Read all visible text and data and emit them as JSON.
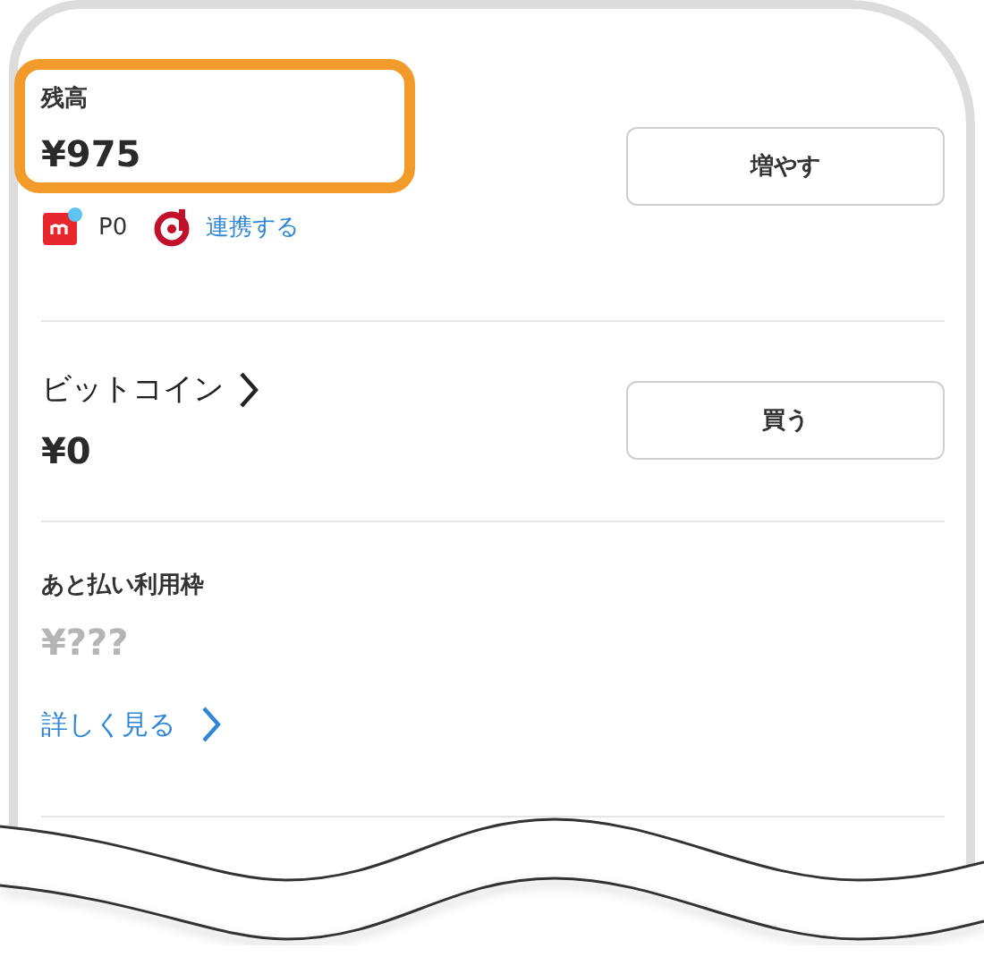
{
  "balance": {
    "label": "残高",
    "amount": "¥975",
    "highlighted": true,
    "button": "増やす",
    "points": "P0",
    "link": "連携する"
  },
  "bitcoin": {
    "title": "ビットコイン",
    "amount": "¥0",
    "button": "買う"
  },
  "later_pay": {
    "label": "あと払い利用枠",
    "amount": "¥???",
    "masked": true,
    "link": "詳しく見る"
  }
}
